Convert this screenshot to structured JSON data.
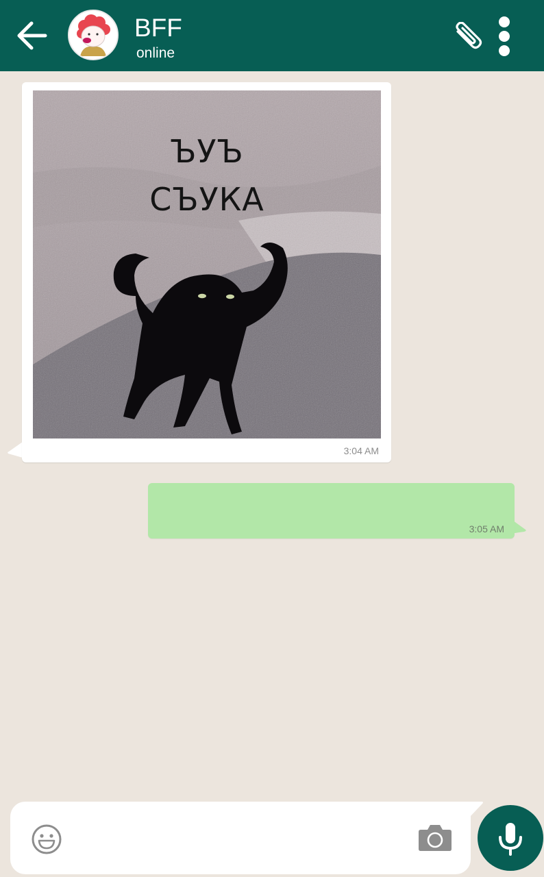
{
  "header": {
    "contact_name": "BFF",
    "status": "online",
    "back_icon": "arrow-left-icon",
    "attach_icon": "paperclip-icon",
    "menu_icon": "vertical-dots-icon",
    "background_color": "#075e54"
  },
  "messages": [
    {
      "direction": "incoming",
      "type": "image",
      "image_caption_line1": "ЪУЪ",
      "image_caption_line2": "СЪУКА",
      "time": "3:04 AM"
    },
    {
      "direction": "outgoing",
      "type": "text",
      "text": "",
      "time": "3:05 AM",
      "bubble_color": "#b2e7a8"
    }
  ],
  "input": {
    "value": "",
    "placeholder": "",
    "emoji_icon": "emoji-icon",
    "camera_icon": "camera-icon",
    "mic_icon": "microphone-icon"
  },
  "colors": {
    "chat_background": "#ece5dd",
    "accent": "#075e54"
  }
}
